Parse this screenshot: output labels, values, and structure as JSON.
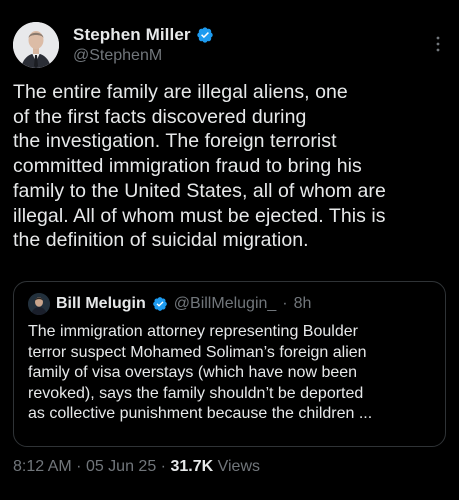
{
  "author": {
    "name": "Stephen Miller",
    "handle": "@StephenM",
    "verified_color": "#1d9bf0"
  },
  "tweet": {
    "text": "The entire family are illegal aliens, one\nof the first facts discovered during\nthe investigation. The foreign terrorist\ncommitted immigration fraud to bring his\nfamily to the United States, all of whom are\nillegal. All of whom must be ejected. This is\nthe definition of suicidal migration."
  },
  "quote": {
    "name": "Bill Melugin",
    "handle": "@BillMelugin_",
    "separator": "·",
    "time": "8h",
    "text": "The immigration attorney representing Boulder\nterror suspect Mohamed Soliman’s foreign alien\nfamily of visa overstays (which have now been\nrevoked), says the family shouldn’t be deported\nas collective punishment because the children ..."
  },
  "meta": {
    "time": "8:12 AM",
    "sep1": "·",
    "date": "05 Jun 25",
    "sep2": "·",
    "views_count": "31.7K",
    "views_label": "Views"
  },
  "icons": {
    "avatar": "avatar-photo",
    "verified": "verified-badge-icon",
    "more": "more-options-icon"
  }
}
